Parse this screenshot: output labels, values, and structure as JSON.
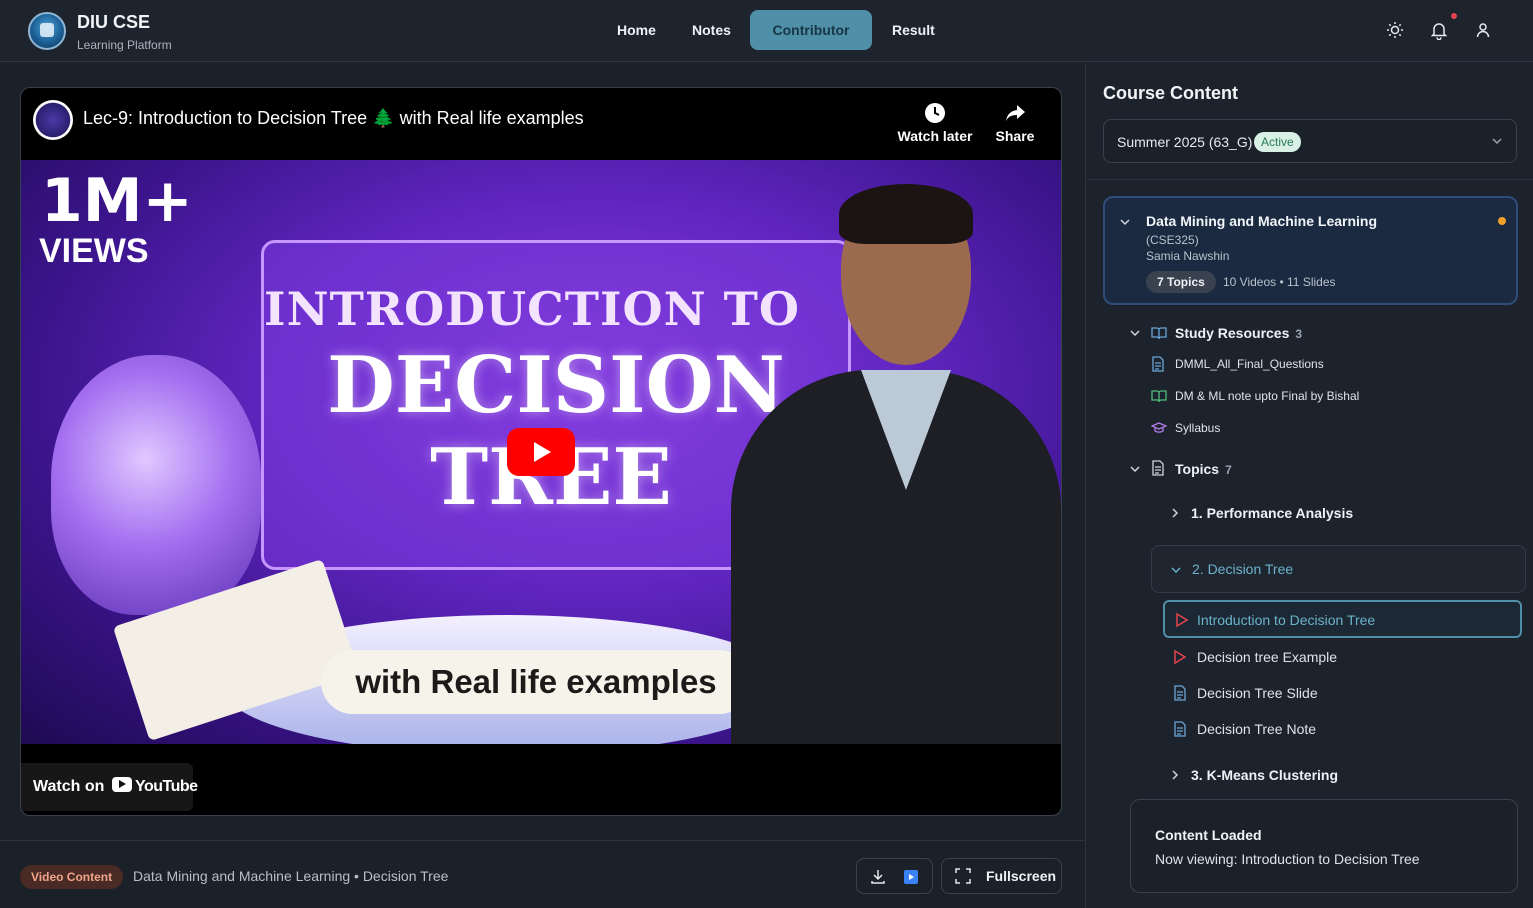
{
  "header": {
    "brand_title": "DIU CSE",
    "brand_subtitle": "Learning Platform",
    "nav": [
      "Home",
      "Notes",
      "Contributor",
      "Result"
    ],
    "active_nav": "Contributor",
    "icons": [
      "sun-icon",
      "bell-icon",
      "user-icon"
    ]
  },
  "player": {
    "video_title": "Lec-9: Introduction to Decision Tree 🌲 with Real life examples",
    "watch_later": "Watch later",
    "share": "Share",
    "thumbnail": {
      "views_big": "1M+",
      "views_small": "VIEWS",
      "line1": "INTRODUCTION TO",
      "line2": "DECISION",
      "line3": "TREE",
      "banner": "with Real life examples"
    },
    "watch_on": "Watch on",
    "youtube": "YouTube"
  },
  "bottom": {
    "badge": "Video Content",
    "breadcrumb": "Data Mining and Machine Learning • Decision Tree",
    "fullscreen": "Fullscreen"
  },
  "sidebar": {
    "title": "Course Content",
    "term": "Summer 2025 (63_G)",
    "term_badge": "Active",
    "course": {
      "name": "Data Mining and Machine Learning",
      "code": "(CSE325)",
      "teacher": "Samia Nawshin",
      "topics_pill": "7 Topics",
      "stats": "10 Videos • 11 Slides"
    },
    "study_resources": {
      "title": "Study Resources",
      "count": "3",
      "items": [
        "DMML_All_Final_Questions",
        "DM & ML note upto Final by Bishal",
        "Syllabus"
      ]
    },
    "topics": {
      "title": "Topics",
      "count": "7",
      "items": [
        "1. Performance Analysis",
        "2. Decision Tree",
        "3. K-Means Clustering"
      ],
      "open_topic_items": [
        "Introduction to Decision Tree",
        "Decision tree Example",
        "Decision Tree Slide",
        "Decision Tree Note"
      ]
    },
    "toast": {
      "title": "Content Loaded",
      "message": "Now viewing: Introduction to Decision Tree"
    }
  },
  "colors": {
    "accent": "#4f8fa8",
    "background": "#1c222b",
    "active_badge": "#d8f0e6",
    "notification_dot": "#e0454f",
    "youtube_red": "#ff0000"
  }
}
